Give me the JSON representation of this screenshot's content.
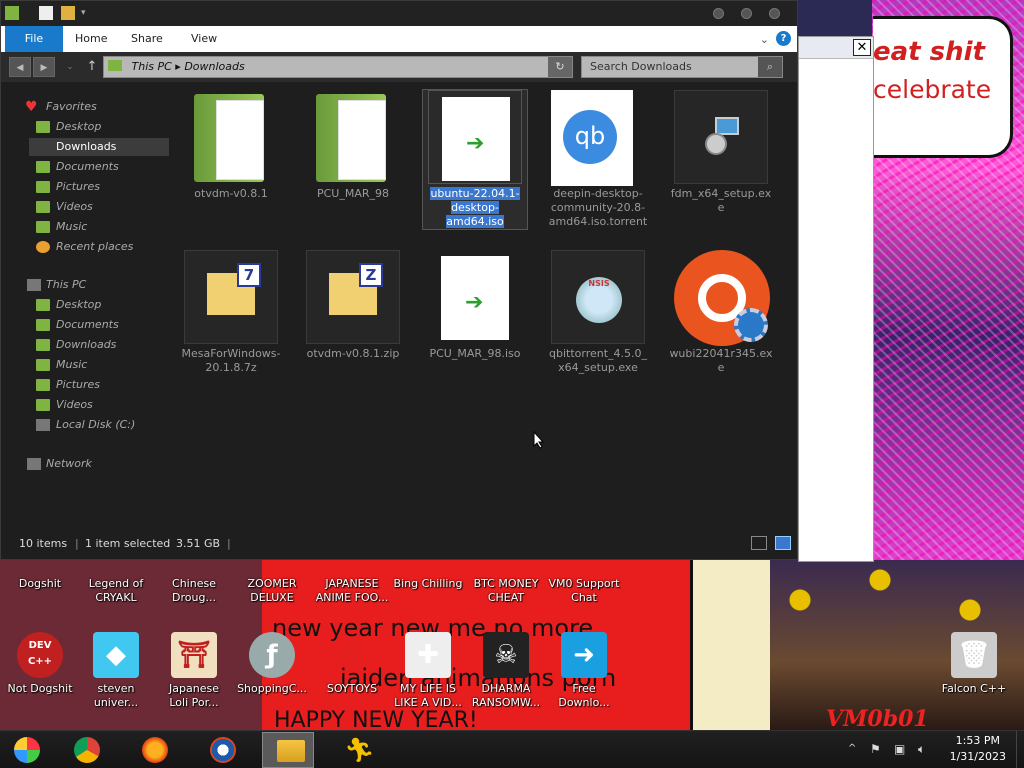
{
  "explorer": {
    "ribbon_tabs": [
      "File",
      "Home",
      "Share",
      "View"
    ],
    "address": {
      "root": "This PC",
      "current": "Downloads"
    },
    "search_placeholder": "Search Downloads",
    "nav": {
      "favorites": "Favorites",
      "fav_items": [
        "Desktop",
        "Downloads",
        "Documents",
        "Pictures",
        "Videos",
        "Music",
        "Recent places"
      ],
      "this_pc": "This PC",
      "pc_items": [
        "Desktop",
        "Documents",
        "Downloads",
        "Music",
        "Pictures",
        "Videos",
        "Local Disk (C:)"
      ],
      "network": "Network"
    },
    "files": [
      {
        "name": "otvdm-v0.8.1",
        "icon": "folder-icon"
      },
      {
        "name": "PCU_MAR_98",
        "icon": "folder-icon"
      },
      {
        "name": "ubuntu-22.04.1-desktop-amd64.iso",
        "icon": "iso-disc-icon",
        "selected": true
      },
      {
        "name": "deepin-desktop-community-20.8-amd64.iso.torrent",
        "icon": "qbittorrent-file-icon"
      },
      {
        "name": "fdm_x64_setup.exe",
        "icon": "setup-installer-icon"
      },
      {
        "name": "MesaForWindows-20.1.8.7z",
        "icon": "7zip-archive-icon"
      },
      {
        "name": "otvdm-v0.8.1.zip",
        "icon": "zip-archive-icon"
      },
      {
        "name": "PCU_MAR_98.iso",
        "icon": "iso-disc-icon"
      },
      {
        "name": "qbittorrent_4.5.0_x64_setup.exe",
        "icon": "nsis-installer-icon"
      },
      {
        "name": "wubi22041r345.exe",
        "icon": "ubuntu-installer-icon"
      }
    ],
    "status": {
      "count": "10 items",
      "selection": "1 item selected",
      "size": "3.51 GB"
    }
  },
  "desktop": {
    "wallpaper_text": {
      "speech_line1": "eat shit",
      "speech_line2": "celebrate",
      "band_line1": "new year new me no more",
      "band_line2": "jaiden animations porn",
      "band_line3": "HAPPY NEW YEAR!",
      "signature": "VM0b01"
    },
    "top_row": [
      {
        "l1": "Dogshit",
        "l2": ""
      },
      {
        "l1": "Legend of",
        "l2": "CRYAKL"
      },
      {
        "l1": "Chinese",
        "l2": "Droug..."
      },
      {
        "l1": "ZOOMER",
        "l2": "DELUXE"
      },
      {
        "l1": "JAPANESE",
        "l2": "ANIME FOO..."
      },
      {
        "l1": "Bing Chilling",
        "l2": ""
      },
      {
        "l1": "BTC MONEY",
        "l2": "CHEAT"
      },
      {
        "l1": "VM0 Support",
        "l2": "Chat"
      }
    ],
    "bottom_row": [
      {
        "l1": "Not Dogshit",
        "l2": "",
        "icon": "devcpp-icon"
      },
      {
        "l1": "steven",
        "l2": "univer...",
        "icon": "diamond-icon"
      },
      {
        "l1": "Japanese",
        "l2": "Loli Por...",
        "icon": "torii-gate-icon"
      },
      {
        "l1": "ShoppingC...",
        "l2": "",
        "icon": "flash-icon"
      },
      {
        "l1": "SOYTOYS",
        "l2": "",
        "icon": "red-s-icon"
      },
      {
        "l1": "MY LIFE IS",
        "l2": "LIKE A VID...",
        "icon": "gamepad-icon"
      },
      {
        "l1": "DHARMA",
        "l2": "RANSOMW...",
        "icon": "skull-icon"
      },
      {
        "l1": "Free",
        "l2": "Downlo...",
        "icon": "download-arrow-icon"
      },
      {
        "l1": "Falcon C++",
        "l2": "",
        "icon": "recycle-bin-icon"
      }
    ]
  },
  "taskbar": {
    "apps": [
      "start-orb-icon",
      "chrome-icon",
      "firefox-icon",
      "obama-logo-icon",
      "file-explorer-icon",
      "aim-running-man-icon"
    ],
    "tray_expand": "^",
    "time": "1:53 PM",
    "date": "1/31/2023"
  }
}
